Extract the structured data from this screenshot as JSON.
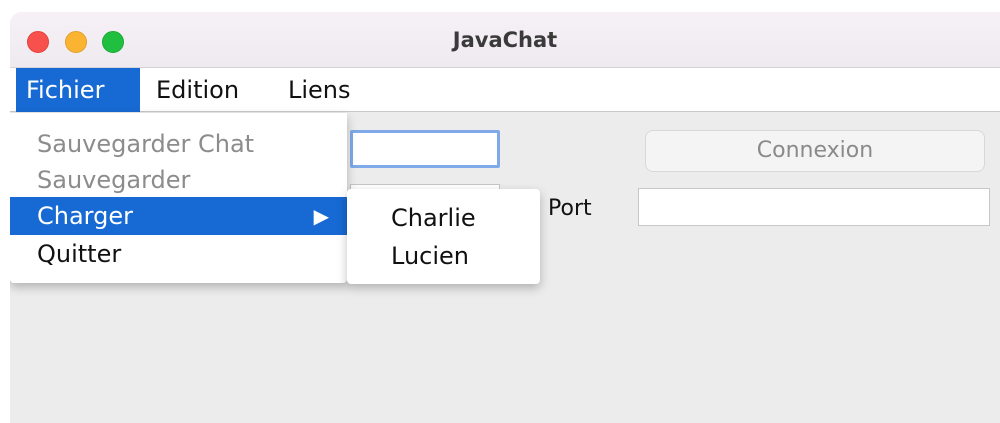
{
  "window": {
    "title": "JavaChat"
  },
  "menubar": {
    "items": [
      {
        "label": "Fichier",
        "active": true
      },
      {
        "label": "Edition",
        "active": false
      },
      {
        "label": "Liens",
        "active": false
      }
    ]
  },
  "fichier_menu": {
    "items": [
      {
        "label": "Sauvegarder Chat",
        "enabled": false
      },
      {
        "label": "Sauvegarder",
        "enabled": false
      },
      {
        "label": "Charger",
        "enabled": true,
        "highlighted": true,
        "has_submenu": true
      },
      {
        "label": "Quitter",
        "enabled": true
      }
    ],
    "submenu_arrow": "▶"
  },
  "charger_submenu": {
    "items": [
      {
        "label": "Charlie"
      },
      {
        "label": "Lucien"
      }
    ]
  },
  "form": {
    "name_value": "",
    "host_value": "",
    "port_label": "Port",
    "port_value": "",
    "connect_button_label": "Connexion"
  },
  "colors": {
    "menu_highlight": "#1769d3",
    "traffic_red": "#f8514d",
    "traffic_yellow": "#fab432",
    "traffic_green": "#21bf3f"
  }
}
